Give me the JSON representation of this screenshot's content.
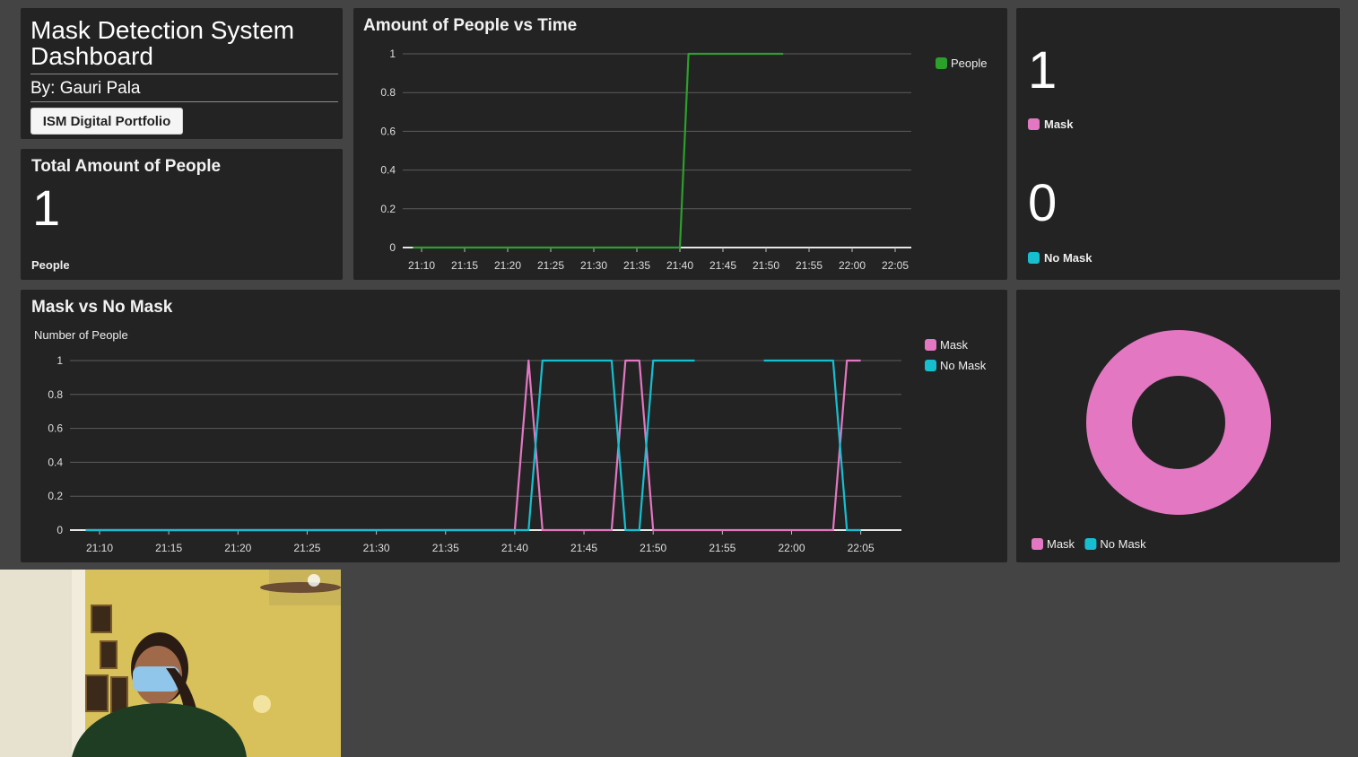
{
  "header": {
    "title": "Mask Detection System Dashboard",
    "author": "By: Gauri Pala",
    "portfolio_button": "ISM Digital Portfolio"
  },
  "total": {
    "title": "Total Amount of People",
    "value": "1",
    "label": "People"
  },
  "counts": {
    "mask_value": "1",
    "mask_label": "Mask",
    "no_mask_value": "0",
    "no_mask_label": "No Mask"
  },
  "colors": {
    "people": "#2ca02c",
    "mask": "#e377c2",
    "no_mask": "#17becf",
    "panel": "#232323",
    "background": "#444444"
  },
  "chart_data": [
    {
      "type": "line",
      "title": "Amount of People vs Time",
      "xlabel": "",
      "ylabel": "",
      "x_ticks": [
        "21:10",
        "21:15",
        "21:20",
        "21:25",
        "21:30",
        "21:35",
        "21:40",
        "21:45",
        "21:50",
        "21:55",
        "22:00",
        "22:05"
      ],
      "ylim": [
        0,
        1
      ],
      "y_ticks": [
        "0",
        "0.2",
        "0.4",
        "0.6",
        "0.8",
        "1"
      ],
      "grid": true,
      "legend": "top-right",
      "series": [
        {
          "name": "People",
          "color": "#2ca02c",
          "x": [
            "21:09",
            "21:40",
            "21:41",
            "21:52",
            "21:57",
            "21:58",
            "22:00",
            "22:05"
          ],
          "y": [
            0,
            0,
            1,
            1,
            null,
            1,
            null,
            1
          ]
        }
      ]
    },
    {
      "type": "line",
      "title": "Mask vs No Mask",
      "xlabel": "",
      "ylabel": "Number of People",
      "x_ticks": [
        "21:10",
        "21:15",
        "21:20",
        "21:25",
        "21:30",
        "21:35",
        "21:40",
        "21:45",
        "21:50",
        "21:55",
        "22:00",
        "22:05"
      ],
      "ylim": [
        0,
        1
      ],
      "y_ticks": [
        "0",
        "0.2",
        "0.4",
        "0.6",
        "0.8",
        "1"
      ],
      "grid": true,
      "legend": "top-right",
      "series": [
        {
          "name": "Mask",
          "color": "#e377c2",
          "x": [
            "21:09",
            "21:40",
            "21:41",
            "21:42",
            "21:47",
            "21:48",
            "21:49",
            "21:50",
            "21:53",
            "22:03",
            "22:04",
            "22:05"
          ],
          "y": [
            0,
            0,
            1,
            0,
            0,
            1,
            1,
            0,
            0,
            0,
            1,
            1
          ]
        },
        {
          "name": "No Mask",
          "color": "#17becf",
          "x": [
            "21:09",
            "21:41",
            "21:42",
            "21:47",
            "21:48",
            "21:49",
            "21:50",
            "21:53",
            "21:57",
            "21:58",
            "22:02",
            "22:03",
            "22:04",
            "22:05"
          ],
          "y": [
            0,
            0,
            1,
            1,
            0,
            0,
            1,
            1,
            null,
            1,
            1,
            1,
            0,
            0
          ]
        }
      ]
    },
    {
      "type": "pie",
      "title": "",
      "donut": true,
      "categories": [
        "Mask",
        "No Mask"
      ],
      "values": [
        1,
        0
      ],
      "colors": [
        "#e377c2",
        "#17becf"
      ],
      "legend": "bottom-left"
    }
  ]
}
